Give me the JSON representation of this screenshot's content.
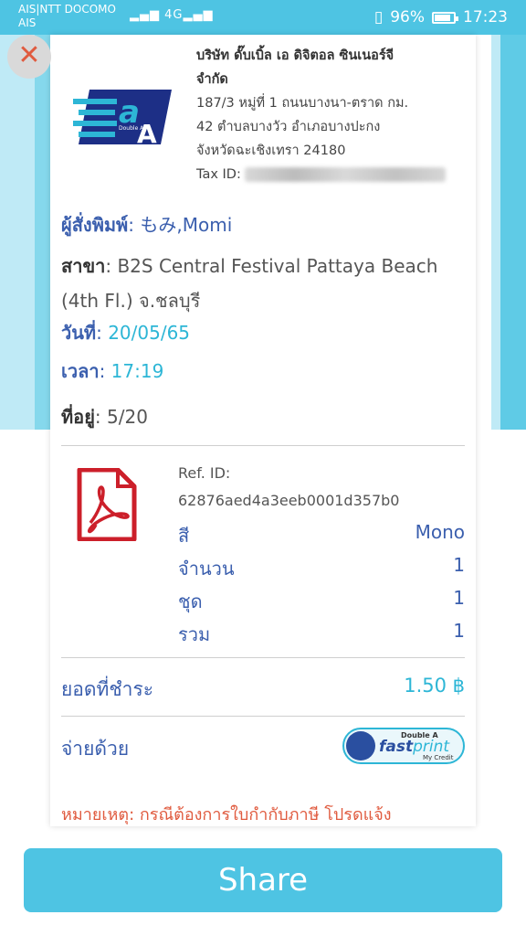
{
  "status_bar": {
    "carrier_line1": "AIS|NTT DOCOMO",
    "carrier_line2": "AIS",
    "signal": "▂▄▆ 4G▂▄▆",
    "battery": "96%",
    "battery_level": 0.96,
    "time": "17:23"
  },
  "close_icon": "close-icon",
  "company": {
    "name_line1": "บริษัท ดั๊บเบิ้ล เอ ดิจิตอล ซินเนอร์จี",
    "name_line2": "จำกัด",
    "addr_line1": "187/3 หมู่ที่ 1 ถนนบางนา-ตราด กม.",
    "addr_line2": "42 ตำบลบางวัว อำเภอบางปะกง",
    "addr_line3": "จังหวัดฉะเชิงเทรา 24180",
    "tax_label": "Tax ID:",
    "logo_text": "Double A"
  },
  "order": {
    "printer_label": "ผู้สั่งพิมพ์",
    "printer_value": "もみ,Momi",
    "branch_label": "สาขา",
    "branch_value": "B2S Central Festival Pattaya Beach (4th Fl.) จ.ชลบุรี",
    "date_label": "วันที่",
    "date_value": "20/05/65",
    "time_label": "เวลา",
    "time_value": "17:19",
    "address_label": "ที่อยู่",
    "address_value": "5/20"
  },
  "job": {
    "file_icon": "pdf-icon",
    "ref_label": "Ref. ID:",
    "ref_id": "62876aed4a3eeb0001d357b0",
    "color_label": "สี",
    "color_value": "Mono",
    "qty_label": "จำนวน",
    "qty_value": "1",
    "set_label": "ชุด",
    "set_value": "1",
    "total_label": "รวม",
    "total_value": "1"
  },
  "payment": {
    "due_label": "ยอดที่ชำระ",
    "due_value": "1.50 ฿",
    "pay_with_label": "จ่ายด้วย",
    "method_small": "Double A",
    "method_fast": "fast",
    "method_print": "print",
    "method_credit": "My Credit"
  },
  "note": "หมายเหตุ: กรณีต้องการใบกำกับภาษี โปรดแจ้ง",
  "share_label": "Share",
  "colors": {
    "accent": "#4ec4e3",
    "blue_text": "#3b5fae",
    "teal_text": "#2db6d6",
    "note_red": "#e05b3f"
  }
}
